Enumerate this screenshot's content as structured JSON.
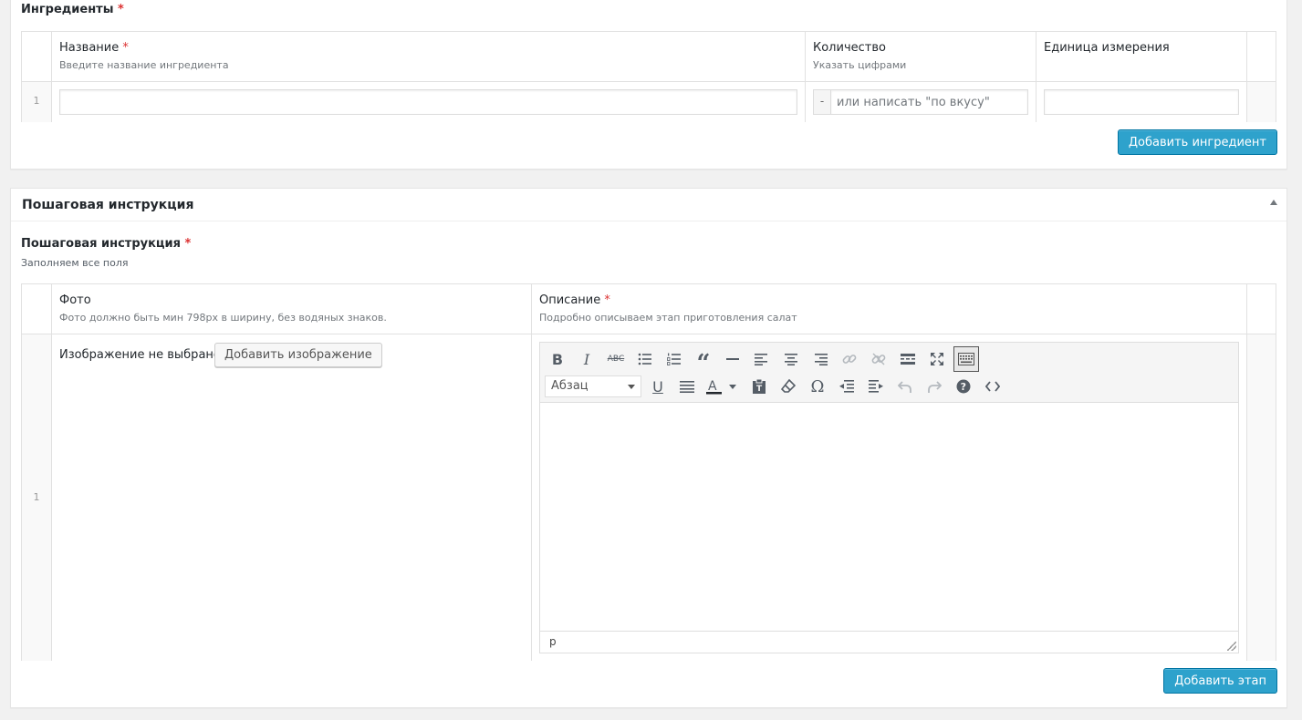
{
  "ingredients": {
    "label": "Ингредиенты",
    "required_mark": "*",
    "columns": [
      {
        "title": "Название",
        "required": "*",
        "desc": "Введите название ингредиента"
      },
      {
        "title": "Количество",
        "required": "",
        "desc": "Указать цифрами"
      },
      {
        "title": "Единица измерения",
        "required": "",
        "desc": ""
      }
    ],
    "rows": [
      {
        "num": "1",
        "name_value": "",
        "qty_prepend": "-",
        "qty_placeholder": "или написать \"по вкусу\"",
        "unit_value": ""
      }
    ],
    "add_button": "Добавить ингредиент"
  },
  "steps_box": {
    "title": "Пошаговая инструкция",
    "label": "Пошаговая инструкция",
    "required_mark": "*",
    "desc": "Заполняем все поля",
    "columns": [
      {
        "title": "Фото",
        "required": "",
        "desc": "Фото должно быть мин 798px в ширину, без водяных знаков."
      },
      {
        "title": "Описание",
        "required": "*",
        "desc": "Подробно описываем этап приготовления салат"
      }
    ],
    "rows": [
      {
        "num": "1",
        "image_status": "Изображение не выбрано",
        "add_image_button": "Добавить изображение"
      }
    ],
    "editor": {
      "format_select": "Абзац",
      "path": "p",
      "toolbar_row1": [
        "bold-icon",
        "italic-icon",
        "strikethrough-icon",
        "bullet-list-icon",
        "numbered-list-icon",
        "blockquote-icon",
        "horizontal-rule-icon",
        "align-left-icon",
        "align-center-icon",
        "align-right-icon",
        "link-icon",
        "unlink-icon",
        "read-more-icon",
        "fullscreen-icon",
        "toolbar-toggle-icon"
      ],
      "toolbar_row2": [
        "underline-icon",
        "justify-icon",
        "text-color-icon",
        "paste-text-icon",
        "clear-formatting-icon",
        "special-char-icon",
        "outdent-icon",
        "indent-icon",
        "undo-icon",
        "redo-icon",
        "help-icon",
        "code-icon"
      ]
    },
    "add_button": "Добавить этап"
  },
  "colors": {
    "primary_button": "#2ea2cc",
    "required": "#dc3232",
    "background": "#f1f1f1"
  }
}
